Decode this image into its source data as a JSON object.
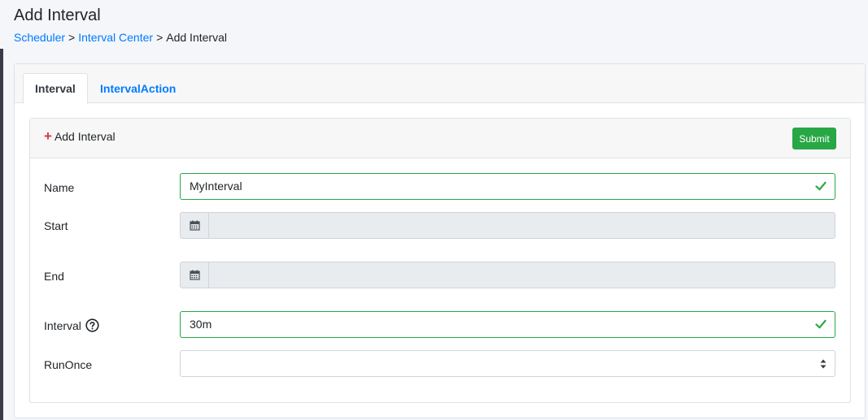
{
  "header": {
    "title": "Add Interval",
    "breadcrumb": {
      "items": [
        "Scheduler",
        "Interval Center"
      ],
      "separator": ">",
      "current": "Add Interval"
    }
  },
  "tabs": [
    {
      "label": "Interval",
      "active": true
    },
    {
      "label": "IntervalAction",
      "active": false
    }
  ],
  "form": {
    "title": "Add Interval",
    "submit_label": "Submit",
    "fields": {
      "name": {
        "label": "Name",
        "value": "MyInterval",
        "valid": true
      },
      "start": {
        "label": "Start",
        "value": "",
        "disabled": true
      },
      "end": {
        "label": "End",
        "value": "",
        "disabled": true
      },
      "interval": {
        "label": "Interval",
        "value": "30m",
        "valid": true
      },
      "runonce": {
        "label": "RunOnce",
        "value": ""
      }
    }
  },
  "colors": {
    "link": "#007bff",
    "success": "#28a745",
    "danger": "#dc3545",
    "disabled_bg": "#e9ecef"
  },
  "icons": {
    "add": "plus-icon",
    "valid": "check-icon",
    "date": "calendar-icon",
    "help": "question-circle-icon",
    "select": "sort-arrows-icon"
  }
}
